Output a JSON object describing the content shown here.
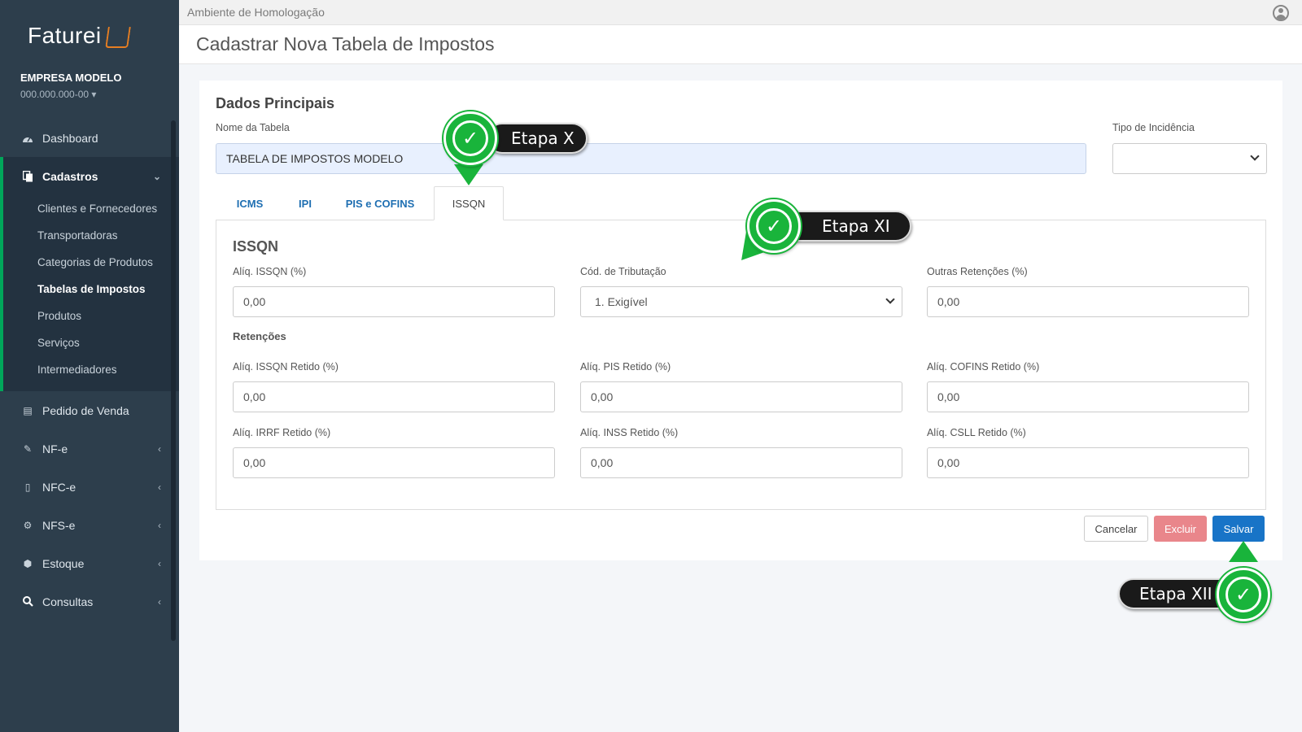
{
  "sidebar": {
    "brand": "Faturei",
    "company_name": "EMPRESA MODELO",
    "company_id": "000.000.000-00",
    "items": [
      {
        "label": "Dashboard",
        "icon": "dashboard-icon"
      },
      {
        "label": "Cadastros",
        "icon": "files-icon",
        "expanded": true
      },
      {
        "label": "Pedido de Venda",
        "icon": "document-icon"
      },
      {
        "label": "NF-e",
        "icon": "document-edit-icon"
      },
      {
        "label": "NFC-e",
        "icon": "file-icon"
      },
      {
        "label": "NFS-e",
        "icon": "gears-icon"
      },
      {
        "label": "Estoque",
        "icon": "box-icon"
      },
      {
        "label": "Consultas",
        "icon": "search-icon"
      }
    ],
    "cadastros_sub": [
      "Clientes e Fornecedores",
      "Transportadoras",
      "Categorias de Produtos",
      "Tabelas de Impostos",
      "Produtos",
      "Serviços",
      "Intermediadores"
    ],
    "active_sub": "Tabelas de Impostos"
  },
  "topbar": {
    "environment": "Ambiente de Homologação"
  },
  "page": {
    "title": "Cadastrar Nova Tabela de Impostos"
  },
  "form": {
    "section_title": "Dados Principais",
    "table_name_label": "Nome da Tabela",
    "table_name_value": "TABELA DE IMPOSTOS MODELO",
    "incidence_label": "Tipo de Incidência",
    "incidence_value": ""
  },
  "tabs": [
    "ICMS",
    "IPI",
    "PIS e COFINS",
    "ISSQN"
  ],
  "active_tab": "ISSQN",
  "issqn": {
    "title": "ISSQN",
    "aliq_label": "Alíq. ISSQN (%)",
    "aliq_value": "0,00",
    "cod_label": "Cód. de Tributação",
    "cod_value": "1. Exigível",
    "outras_label": "Outras Retenções (%)",
    "outras_value": "0,00",
    "retencoes_title": "Retenções",
    "retido_issqn_label": "Alíq. ISSQN Retido (%)",
    "retido_issqn_value": "0,00",
    "retido_pis_label": "Alíq. PIS Retido (%)",
    "retido_pis_value": "0,00",
    "retido_cofins_label": "Alíq. COFINS Retido (%)",
    "retido_cofins_value": "0,00",
    "retido_irrf_label": "Alíq. IRRF Retido (%)",
    "retido_irrf_value": "0,00",
    "retido_inss_label": "Alíq. INSS Retido (%)",
    "retido_inss_value": "0,00",
    "retido_csll_label": "Alíq. CSLL Retido (%)",
    "retido_csll_value": "0,00"
  },
  "buttons": {
    "cancel": "Cancelar",
    "delete": "Excluir",
    "save": "Salvar"
  },
  "callouts": {
    "step10": "Etapa X",
    "step11": "Etapa XI",
    "step12": "Etapa XII"
  },
  "colors": {
    "sidebar": "#2d3e4c",
    "accent_green": "#19b43b",
    "save_blue": "#1874c7",
    "delete_red": "#e9868b",
    "link_blue": "#1f6fb2"
  }
}
